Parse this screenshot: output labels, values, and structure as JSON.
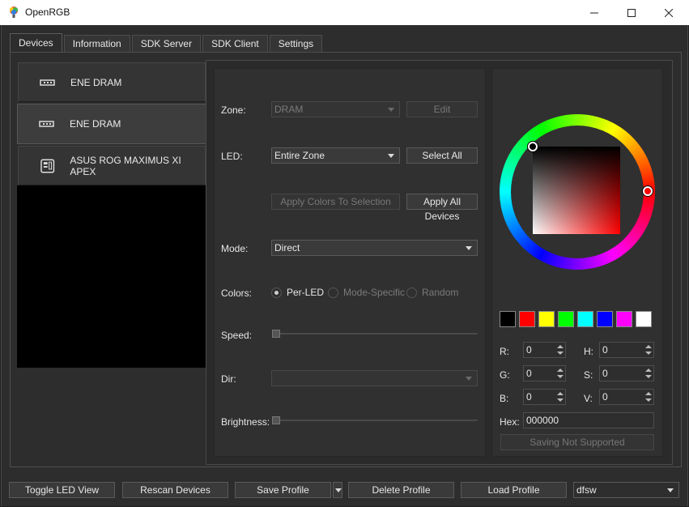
{
  "window": {
    "title": "OpenRGB",
    "minimize_icon": "minimize-icon",
    "maximize_icon": "maximize-icon",
    "close_icon": "close-icon"
  },
  "tabs": [
    {
      "label": "Devices",
      "active": true
    },
    {
      "label": "Information",
      "active": false
    },
    {
      "label": "SDK Server",
      "active": false
    },
    {
      "label": "SDK Client",
      "active": false
    },
    {
      "label": "Settings",
      "active": false
    }
  ],
  "devices": [
    {
      "label": "ENE DRAM",
      "icon": "ram-icon"
    },
    {
      "label": "ENE DRAM",
      "icon": "ram-icon"
    },
    {
      "label": "ASUS ROG MAXIMUS XI APEX",
      "icon": "motherboard-icon"
    }
  ],
  "controls": {
    "zone_label": "Zone:",
    "zone_value": "DRAM",
    "edit_button": "Edit",
    "led_label": "LED:",
    "led_value": "Entire Zone",
    "select_all_button": "Select All",
    "apply_selection_button": "Apply Colors To Selection",
    "apply_all_button": "Apply All Devices",
    "mode_label": "Mode:",
    "mode_value": "Direct",
    "colors_label": "Colors:",
    "radio_per_led": "Per-LED",
    "radio_mode_specific": "Mode-Specific",
    "radio_random": "Random",
    "speed_label": "Speed:",
    "dir_label": "Dir:",
    "dir_value": "",
    "brightness_label": "Brightness:"
  },
  "color_picker": {
    "swatches": [
      "#000000",
      "#ff0000",
      "#ffff00",
      "#00ff00",
      "#00ffff",
      "#0000ff",
      "#ff00ff",
      "#ffffff"
    ],
    "r_label": "R:",
    "r_value": "0",
    "g_label": "G:",
    "g_value": "0",
    "b_label": "B:",
    "b_value": "0",
    "h_label": "H:",
    "h_value": "0",
    "s_label": "S:",
    "s_value": "0",
    "v_label": "V:",
    "v_value": "0",
    "hex_label": "Hex:",
    "hex_value": "000000",
    "saving_button": "Saving Not Supported"
  },
  "bottom_bar": {
    "toggle_led_view": "Toggle LED View",
    "rescan_devices": "Rescan Devices",
    "save_profile": "Save Profile",
    "delete_profile": "Delete Profile",
    "load_profile": "Load Profile",
    "profile_value": "dfsw"
  }
}
